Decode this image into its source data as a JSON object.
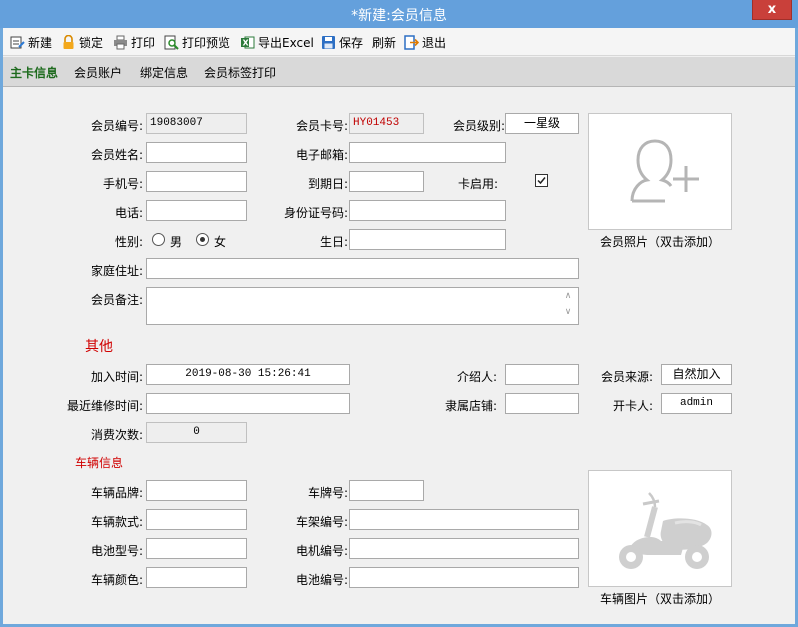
{
  "window": {
    "title": "*新建:会员信息",
    "close_glyph": "x"
  },
  "toolbar": {
    "new": "新建",
    "lock": "锁定",
    "print": "打印",
    "preview": "打印预览",
    "export": "导出Excel",
    "save": "保存",
    "refresh": "刷新",
    "exit": "退出"
  },
  "tabs": [
    "主卡信息",
    "会员账户",
    "绑定信息",
    "会员标签打印"
  ],
  "member": {
    "no_label": "会员编号:",
    "no_value": "19083007",
    "card_label": "会员卡号:",
    "card_value": "HY01453",
    "level_label": "会员级别:",
    "level_value": "一星级",
    "name_label": "会员姓名:",
    "name_value": "",
    "email_label": "电子邮箱:",
    "email_value": "",
    "mobile_label": "手机号:",
    "mobile_value": "",
    "expire_label": "到期日:",
    "expire_value": "",
    "enabled_label": "卡启用:",
    "enabled_checked": true,
    "phone_label": "电话:",
    "phone_value": "",
    "id_label": "身份证号码:",
    "id_value": "",
    "gender_label": "性别:",
    "gender_male": "男",
    "gender_female": "女",
    "gender_selected": "女",
    "birthday_label": "生日:",
    "birthday_value": "",
    "address_label": "家庭住址:",
    "address_value": "",
    "remark_label": "会员备注:",
    "remark_value": "",
    "photo_caption": "会员照片（双击添加）"
  },
  "other": {
    "section_title": "其他",
    "join_label": "加入时间:",
    "join_value": "2019-08-30 15:26:41",
    "referrer_label": "介绍人:",
    "referrer_value": "",
    "source_label": "会员来源:",
    "source_value": "自然加入",
    "repair_label": "最近维修时间:",
    "repair_value": "",
    "store_label": "隶属店铺:",
    "store_value": "",
    "opener_label": "开卡人:",
    "opener_value": "admin",
    "count_label": "消费次数:",
    "count_value": "0"
  },
  "vehicle": {
    "section_title": "车辆信息",
    "brand_label": "车辆品牌:",
    "brand_value": "",
    "plate_label": "车牌号:",
    "plate_value": "",
    "model_label": "车辆款式:",
    "model_value": "",
    "frame_label": "车架编号:",
    "frame_value": "",
    "battery_type_label": "电池型号:",
    "battery_type_value": "",
    "motor_label": "电机编号:",
    "motor_value": "",
    "color_label": "车辆颜色:",
    "color_value": "",
    "battery_no_label": "电池编号:",
    "battery_no_value": "",
    "photo_caption": "车辆图片（双击添加）"
  }
}
